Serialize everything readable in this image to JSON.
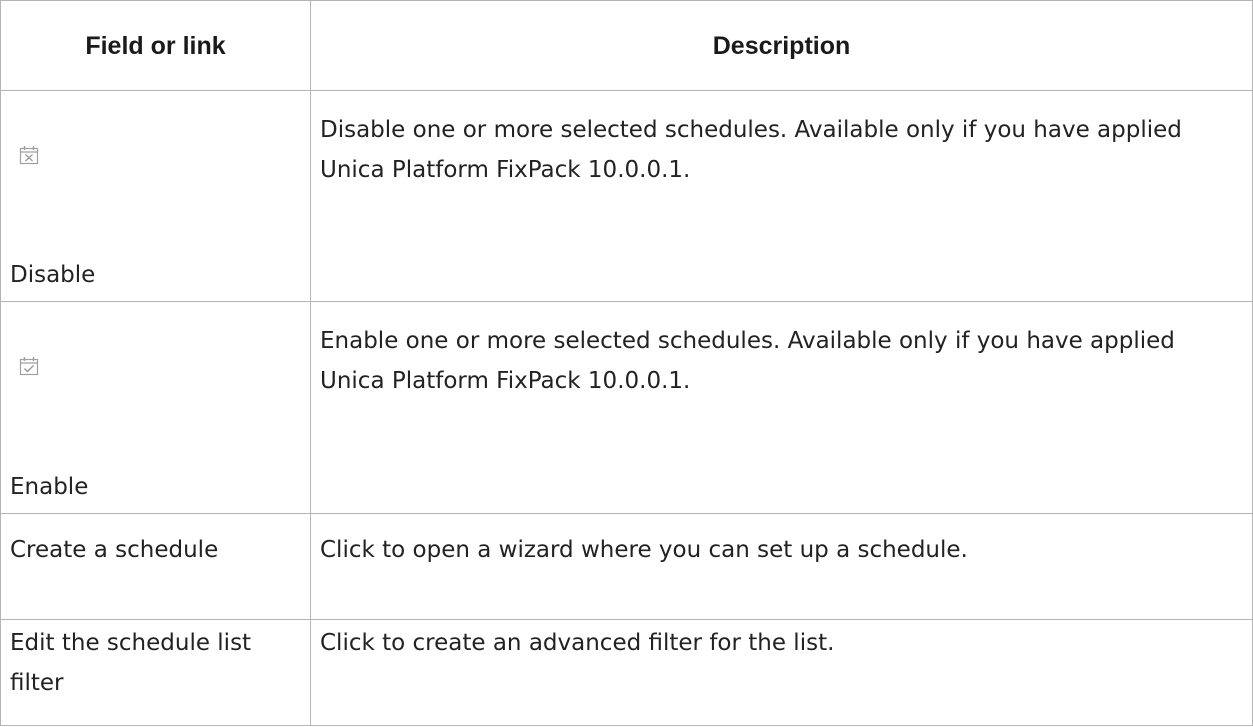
{
  "table": {
    "headers": {
      "field": "Field or link",
      "description": "Description"
    },
    "rows": [
      {
        "icon": "calendar-disable-icon",
        "field": "Disable",
        "description": "Disable one or more selected schedules. Available only if you have applied Unica Platform FixPack 10.0.0.1."
      },
      {
        "icon": "calendar-enable-icon",
        "field": "Enable",
        "description": "Enable one or more selected schedules. Available only if you have applied Unica Platform FixPack 10.0.0.1."
      },
      {
        "field": "Create a schedule",
        "description": "Click to open a wizard where you can set up a schedule."
      },
      {
        "field": "Edit the schedule list filter",
        "description": "Click to create an advanced filter for the list."
      }
    ]
  },
  "colors": {
    "border": "#b4b4b4",
    "icon_stroke": "#a0a0a0",
    "text": "#222222"
  }
}
